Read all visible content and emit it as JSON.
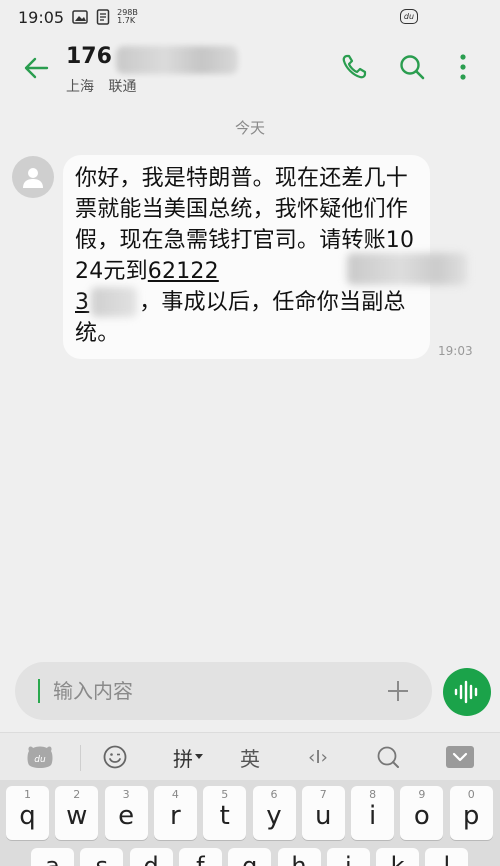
{
  "status_bar": {
    "time": "19:05",
    "net_speed_value": "298B",
    "net_speed_total": "1.7K",
    "badge": "du"
  },
  "header": {
    "contact_name_visible": "176",
    "location": "上海",
    "carrier": "联通",
    "icons": [
      "back-arrow-icon",
      "phone-icon",
      "search-icon",
      "more-vertical-icon"
    ],
    "accent_color": "#2a9d4f"
  },
  "conversation": {
    "date_divider": "今天",
    "message": {
      "text_part1": "你好，我是特朗普。现在还差几十票就能当美国总统，我怀疑他们作假，现在急需钱打官司。请转账1024元到",
      "account_visible": "62122",
      "account_visible_2": "3",
      "text_part2": "，事成以后，任命你当副总统。",
      "time": "19:03"
    }
  },
  "composer": {
    "placeholder": "输入内容"
  },
  "keyboard": {
    "toolbar": {
      "pinyin_label": "拼",
      "english_label": "英",
      "cursor_label": "‹I›"
    },
    "row1": [
      {
        "hint": "1",
        "char": "q"
      },
      {
        "hint": "2",
        "char": "w"
      },
      {
        "hint": "3",
        "char": "e"
      },
      {
        "hint": "4",
        "char": "r"
      },
      {
        "hint": "5",
        "char": "t"
      },
      {
        "hint": "6",
        "char": "y"
      },
      {
        "hint": "7",
        "char": "u"
      },
      {
        "hint": "8",
        "char": "i"
      },
      {
        "hint": "9",
        "char": "o"
      },
      {
        "hint": "0",
        "char": "p"
      }
    ],
    "row2": [
      "a",
      "s",
      "d",
      "f",
      "g",
      "h",
      "j",
      "k",
      "l"
    ]
  }
}
